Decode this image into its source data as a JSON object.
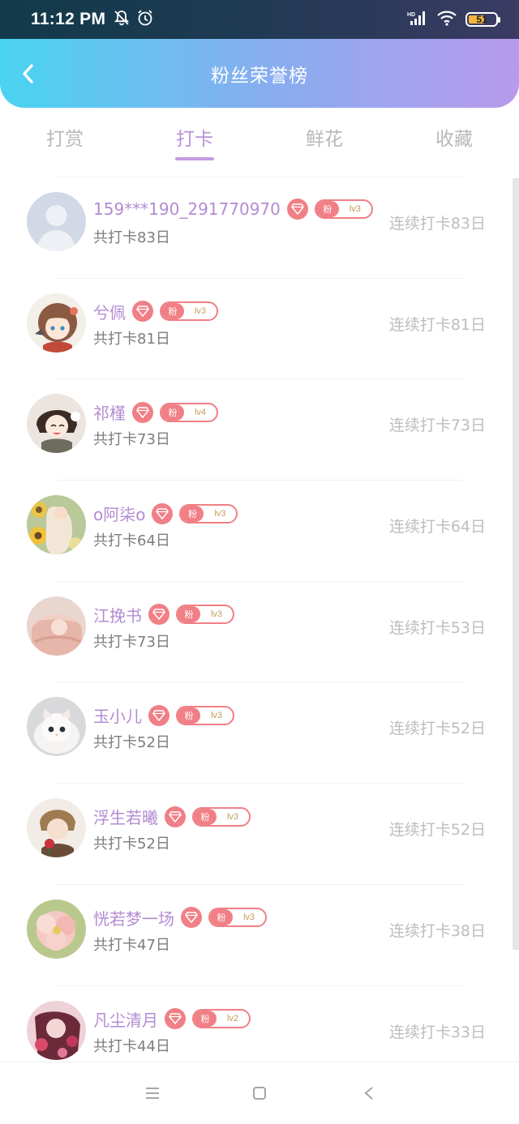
{
  "status_bar": {
    "time": "11:12 PM",
    "battery_level": "51",
    "icons": [
      "mute-bell-icon",
      "alarm-clock-icon",
      "hd-signal-icon",
      "wifi-icon",
      "battery-icon"
    ]
  },
  "header": {
    "title": "粉丝荣誉榜",
    "back_icon": "chevron-left-icon"
  },
  "tabs": [
    {
      "label": "打赏",
      "active": false
    },
    {
      "label": "打卡",
      "active": true
    },
    {
      "label": "鲜花",
      "active": false
    },
    {
      "label": "收藏",
      "active": false
    }
  ],
  "badge_prefix": "粉",
  "colors": {
    "accent": "#b993d6",
    "badge": "#f07f86",
    "muted_text": "#bdbdc2",
    "header_gradient": [
      "#49d4f0",
      "#86aef0",
      "#b89aec"
    ]
  },
  "fans": [
    {
      "name": "159***190_291770970",
      "level": "lv3",
      "total": "共打卡83日",
      "streak": "连续打卡83日",
      "avatar": "default-person"
    },
    {
      "name": "兮佩",
      "level": "lv3",
      "total": "共打卡81日",
      "streak": "连续打卡81日",
      "avatar": "anime-girl"
    },
    {
      "name": "祁槿",
      "level": "lv4",
      "total": "共打卡73日",
      "streak": "连续打卡73日",
      "avatar": "anime-boy"
    },
    {
      "name": "o阿柒o",
      "level": "lv3",
      "total": "共打卡64日",
      "streak": "连续打卡64日",
      "avatar": "sunflower"
    },
    {
      "name": "江挽书",
      "level": "lv3",
      "total": "共打卡73日",
      "streak": "连续打卡53日",
      "avatar": "pink-scarf"
    },
    {
      "name": "玉小儿",
      "level": "lv3",
      "total": "共打卡52日",
      "streak": "连续打卡52日",
      "avatar": "white-kitten"
    },
    {
      "name": "浮生若曦",
      "level": "lv3",
      "total": "共打卡52日",
      "streak": "连续打卡52日",
      "avatar": "anime-rose"
    },
    {
      "name": "恍若梦一场",
      "level": "lv3",
      "total": "共打卡47日",
      "streak": "连续打卡38日",
      "avatar": "pink-flower"
    },
    {
      "name": "凡尘清月",
      "level": "lv2",
      "total": "共打卡44日",
      "streak": "连续打卡33日",
      "avatar": "dark-anime"
    }
  ],
  "nav_bar": {
    "icons": [
      "menu-icon",
      "home-square-icon",
      "back-triangle-icon"
    ]
  }
}
